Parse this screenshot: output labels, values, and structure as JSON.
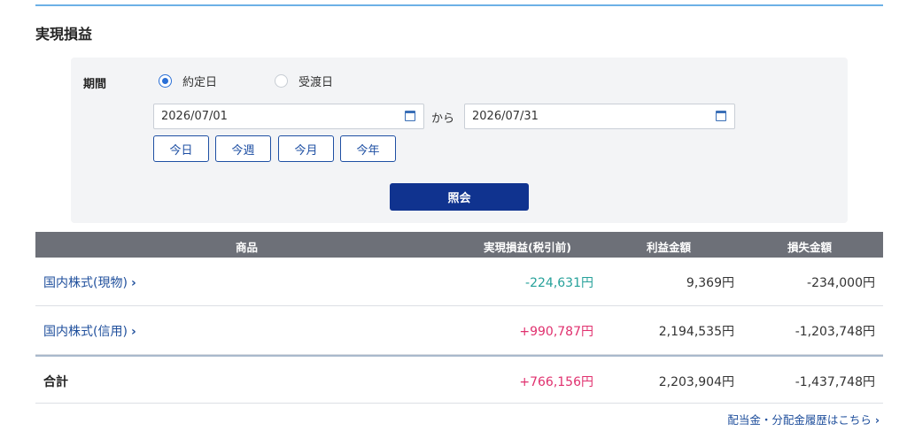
{
  "section_title": "実現損益",
  "filter": {
    "period_label": "期間",
    "radio_options": [
      {
        "label": "約定日",
        "checked": true
      },
      {
        "label": "受渡日",
        "checked": false
      }
    ],
    "date_from": "2026/07/01",
    "connector": "から",
    "date_to": "2026/07/31",
    "quick_buttons": [
      "今日",
      "今週",
      "今月",
      "今年"
    ],
    "submit_label": "照会"
  },
  "table": {
    "headers": {
      "product": "商品",
      "realized_pl": "実現損益(税引前)",
      "profit_amount": "利益金額",
      "loss_amount": "損失金額"
    },
    "rows": [
      {
        "product": "国内株式(現物)",
        "chevron": "›",
        "realized_pl": "-224,631円",
        "profit_amount": "9,369円",
        "loss_amount": "-234,000円"
      },
      {
        "product": "国内株式(信用)",
        "chevron": "›",
        "realized_pl": "+990,787円",
        "profit_amount": "2,194,535円",
        "loss_amount": "-1,203,748円"
      }
    ],
    "total": {
      "label": "合計",
      "realized_pl": "+766,156円",
      "profit_amount": "2,203,904円",
      "loss_amount": "-1,437,748円"
    }
  },
  "footer_link": "配当金・分配金履歴はこちら",
  "footer_chevron": "›",
  "colors": {
    "accent_blue": "#10338f",
    "negative_green": "#26a19a",
    "positive_pink": "#e0306e",
    "header_gray": "#6d7078"
  }
}
